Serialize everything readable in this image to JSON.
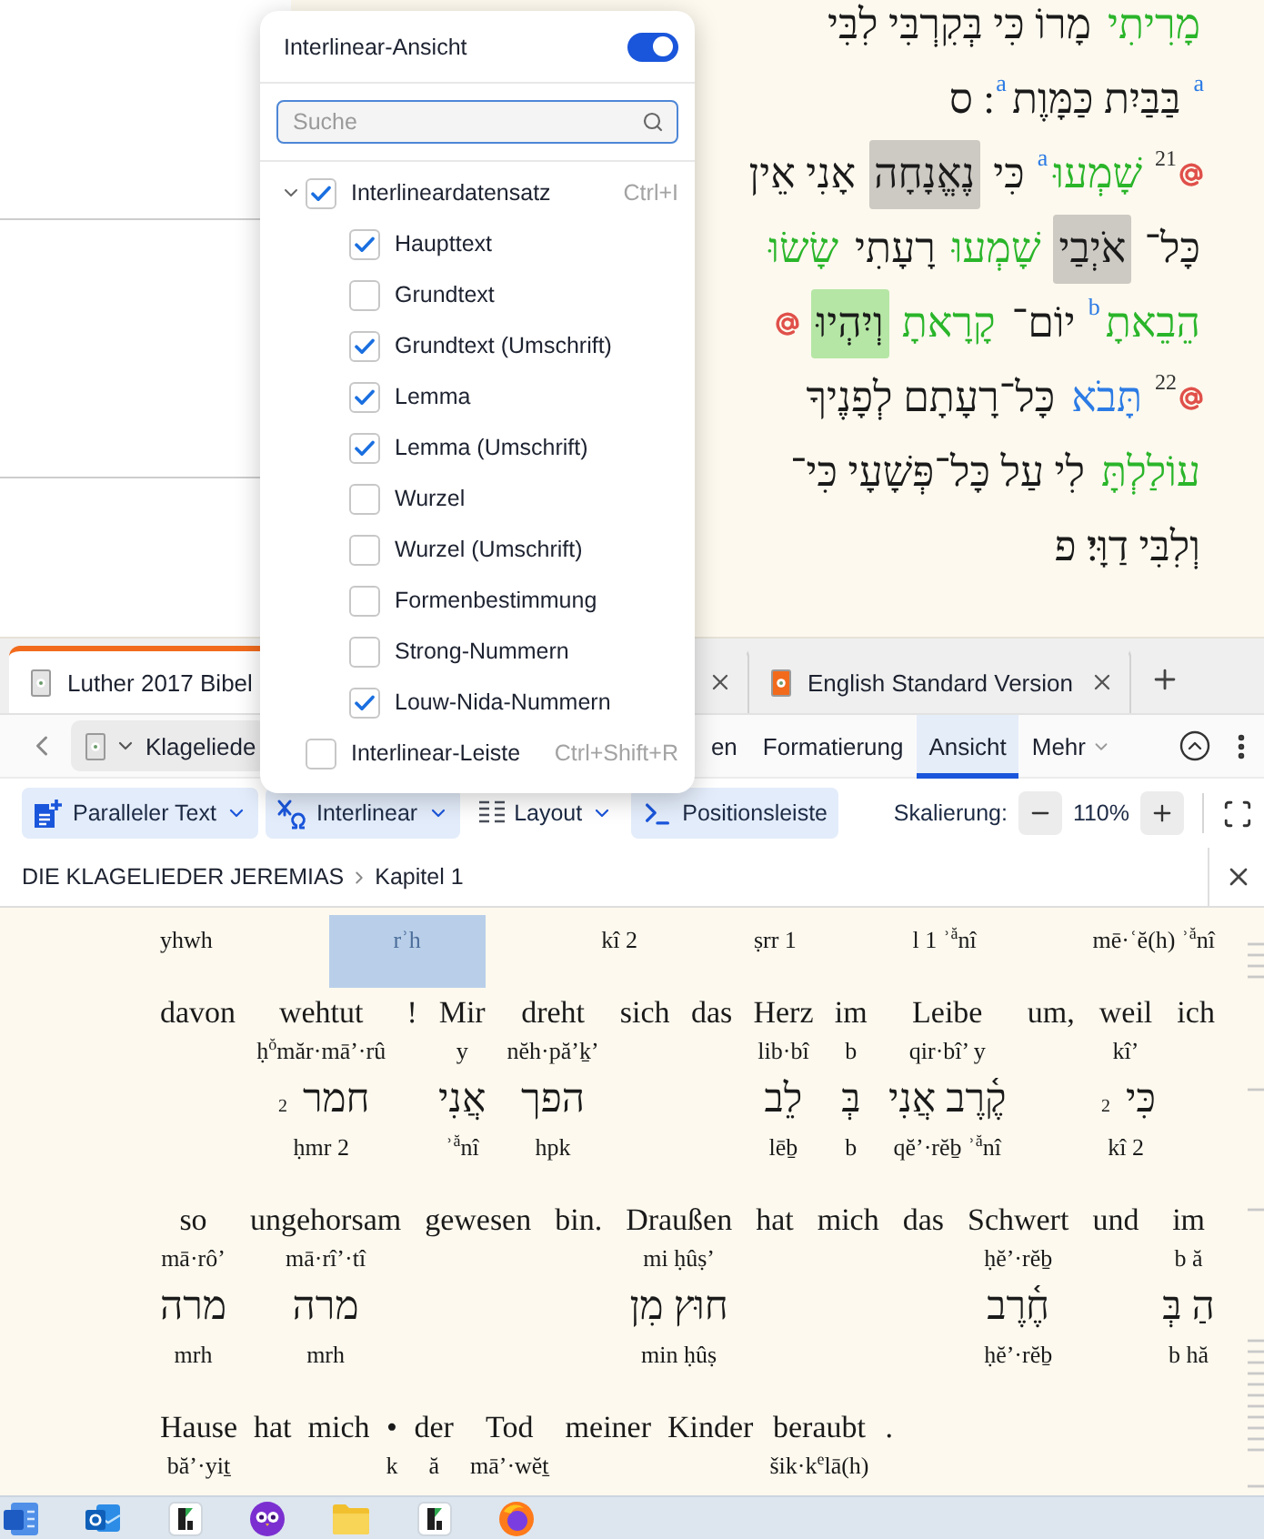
{
  "hebrew_text": {
    "lines": [
      {
        "segments": [
          {
            "kind": "word",
            "text": "מָרִיתִי",
            "color": "#2ab52a"
          },
          {
            "kind": "word",
            "text": "מָרוֹ כִּי בְּקִרְבִּי לִבִּי",
            "color": "#1a1a1a"
          }
        ]
      },
      {
        "segments": [
          {
            "kind": "note",
            "text": "a",
            "color": "#2c7be5"
          },
          {
            "kind": "word",
            "text": "בַּבַּיִת כַּמָּוֶת",
            "color": "#1a1a1a"
          },
          {
            "kind": "note",
            "text": "a",
            "color": "#2c7be5"
          },
          {
            "kind": "word",
            "text": "׃ ס",
            "color": "#1a1a1a"
          }
        ]
      },
      {
        "segments": [
          {
            "kind": "link"
          },
          {
            "kind": "verse",
            "text": "21"
          },
          {
            "kind": "word",
            "text": "שָׁמְעוּ",
            "color": "#2ab52a"
          },
          {
            "kind": "note",
            "text": "a",
            "color": "#2c7be5"
          },
          {
            "kind": "word",
            "text": "כִּי",
            "color": "#1a1a1a"
          },
          {
            "kind": "highlight",
            "text": "נֶאֱנָחָה",
            "color": "#cdc9c3"
          },
          {
            "kind": "word",
            "text": "אָנִי אֵין",
            "color": "#1a1a1a"
          }
        ]
      },
      {
        "segments": [
          {
            "kind": "word",
            "text": "כָּל־",
            "color": "#1a1a1a"
          },
          {
            "kind": "highlight",
            "text": "אֹיְבַי",
            "color": "#cdc9c3"
          },
          {
            "kind": "word",
            "text": "שָׁמְעוּ",
            "color": "#2ab52a"
          },
          {
            "kind": "word",
            "text": "רָעָתִי",
            "color": "#1a1a1a"
          },
          {
            "kind": "word",
            "text": "שָׂשׂוּ",
            "color": "#2ab52a"
          }
        ]
      },
      {
        "segments": [
          {
            "kind": "word",
            "text": "הֵבֵאתָ",
            "color": "#2ab52a"
          },
          {
            "kind": "note",
            "text": "b",
            "color": "#2c7be5"
          },
          {
            "kind": "word",
            "text": "יוֹם־",
            "color": "#1a1a1a"
          },
          {
            "kind": "word",
            "text": "קָרָאתָ",
            "color": "#2ab52a"
          },
          {
            "kind": "highlight",
            "text": "וְיִהְיוּ",
            "color": "#b5e6a5"
          },
          {
            "kind": "link"
          }
        ]
      },
      {
        "segments": [
          {
            "kind": "link"
          },
          {
            "kind": "verse",
            "text": "22"
          },
          {
            "kind": "word",
            "text": "תָּבֹא",
            "color": "#2c7be5"
          },
          {
            "kind": "word",
            "text": "כָּל־רָעָתָם לְפָנֶיךָ",
            "color": "#1a1a1a"
          }
        ]
      },
      {
        "segments": [
          {
            "kind": "word",
            "text": "עוֹלַלְתָּ",
            "color": "#2ab52a"
          },
          {
            "kind": "word",
            "text": "לִי עַל כָּל־פְּשָׁעָי כִּי־",
            "color": "#1a1a1a"
          }
        ]
      },
      {
        "segments": [
          {
            "kind": "word",
            "text": "וְלִבִּי דַוָּי׃ פ",
            "color": "#1a1a1a"
          }
        ]
      }
    ]
  },
  "document_tabs": [
    {
      "label": "Luther 2017 Bibel",
      "selected": true,
      "color": "#e4e4e4"
    },
    {
      "selected": false
    },
    {
      "label": "English Standard Version",
      "selected": false,
      "color": "#f26a1b"
    }
  ],
  "navigation_bar": {
    "book_select": {
      "label": "Klageliede",
      "color": "#e4e4e4"
    },
    "tabs": [
      {
        "label": "en",
        "selected": false,
        "kind": "tab"
      },
      {
        "label": "Formatierung",
        "selected": false,
        "kind": "tab"
      },
      {
        "label": "Ansicht",
        "selected": true,
        "kind": "tab"
      },
      {
        "label": "Mehr",
        "selected": false,
        "kind": "menu"
      }
    ]
  },
  "view_toolbar": {
    "buttons": [
      {
        "label": "Paralleler Text",
        "on": true,
        "kind": "dropdown"
      },
      {
        "label": "Interlinear",
        "on": true,
        "kind": "dropdown"
      },
      {
        "label": "Layout",
        "on": false,
        "kind": "dropdown"
      },
      {
        "label": "Positionsleiste",
        "on": true,
        "kind": "toggle"
      }
    ],
    "zoom": {
      "label": "Skalierung:",
      "value": "110%"
    }
  },
  "breadcrumb": {
    "items": [
      "DIE KLAGELIEDER JEREMIAS",
      "Kapitel 1"
    ]
  },
  "interlinear": {
    "rows": [
      {
        "columns": [
          {
            "lemma_umschrift": "yhwh",
            "selected": false
          },
          {
            "lemma_umschrift": "rʾh",
            "selected": true
          },
          {
            "lemma_umschrift": "kî 2",
            "selected": false
          },
          {
            "lemma_umschrift": "ṣrr 1",
            "selected": false
          },
          {
            "lemma_umschrift": "l 1 ʾ$^{ă}$nî",
            "selected": false
          },
          {
            "lemma_umschrift": "mē·ʿĕ(h) ʾ$^{ă}$nî",
            "selected": false
          }
        ]
      },
      {
        "columns": [
          {
            "haupttext": "davon",
            "selected": false
          },
          {
            "haupttext": "wehtut",
            "grundtext_umschrift": "ḥ$^{ŏ}$măr·mā’·rû",
            "lemma_umschrift": "ḥmr 2",
            "selected": false
          },
          {
            "haupttext": "!",
            "selected": false
          },
          {
            "haupttext": "Mir",
            "grundtext_umschrift": "y",
            "lemma_umschrift": "ʾ$^{ă}$nî",
            "selected": false
          },
          {
            "haupttext": "dreht",
            "grundtext_umschrift": "nĕh·pă’ḵ’",
            "lemma_umschrift": "hpk",
            "selected": false
          },
          {
            "haupttext": "sich",
            "selected": false
          },
          {
            "haupttext": "das",
            "selected": false
          },
          {
            "haupttext": "Herz",
            "grundtext_umschrift": "lib·bî",
            "lemma_umschrift": "lēḇ",
            "selected": false
          },
          {
            "haupttext": "im",
            "grundtext_umschrift": "b",
            "lemma_umschrift": "b",
            "selected": false
          },
          {
            "haupttext": "Leibe",
            "grundtext_umschrift": "qir·bî’ y",
            "lemma_umschrift": "qĕ’·rĕḇ ʾ$^{ă}$nî",
            "selected": false
          },
          {
            "haupttext": "um,",
            "selected": false
          },
          {
            "haupttext": "weil",
            "grundtext_umschrift": "kî’",
            "lemma_umschrift": "kî 2",
            "selected": false
          },
          {
            "haupttext": "ich",
            "selected": false
          }
        ],
        "lemmas": [
          "כִּי $_{2}$",
          "קֶ֫רֶב אֲנִי",
          "בְּ",
          "לֵב",
          "הפך",
          "אֲנִי",
          "חמר $_{2}$"
        ]
      },
      {
        "columns": [
          {
            "haupttext": "so",
            "grundtext_umschrift": "mā·rô’",
            "lemma_umschrift": "mrh",
            "selected": false
          },
          {
            "haupttext": "ungehorsam",
            "grundtext_umschrift": "mā·rî’·tî",
            "lemma_umschrift": "mrh",
            "selected": false
          },
          {
            "haupttext": "gewesen",
            "selected": false
          },
          {
            "haupttext": "bin.",
            "selected": false
          },
          {
            "haupttext": "Draußen",
            "grundtext_umschrift": "mi ḥûṣ’",
            "lemma_umschrift": "min ḥûṣ",
            "selected": false
          },
          {
            "haupttext": "hat",
            "selected": false
          },
          {
            "haupttext": "mich",
            "selected": false
          },
          {
            "haupttext": "das",
            "selected": false
          },
          {
            "haupttext": "Schwert",
            "grundtext_umschrift": "ḥĕ’·rĕḇ",
            "lemma_umschrift": "ḥĕ’·rĕḇ",
            "selected": false
          },
          {
            "haupttext": "und",
            "selected": false
          },
          {
            "haupttext": "im",
            "grundtext_umschrift": "b ă",
            "lemma_umschrift": "b hă",
            "selected": false
          }
        ],
        "lemmas": [
          "הַ בְּ",
          "חֶ֫רֶב",
          "חוּץ מִן",
          "מרה",
          "מרה"
        ]
      },
      {
        "columns": [
          {
            "haupttext": "Hause",
            "grundtext_umschrift": "bă’·yiṯ",
            "selected": false
          },
          {
            "haupttext": "hat",
            "selected": false
          },
          {
            "haupttext": "mich",
            "selected": false
          },
          {
            "haupttext": "•",
            "grundtext_umschrift": "k",
            "selected": false
          },
          {
            "haupttext": "der",
            "grundtext_umschrift": "ă",
            "selected": false
          },
          {
            "haupttext": "Tod",
            "grundtext_umschrift": "mā’·wĕṯ",
            "selected": false
          },
          {
            "haupttext": "meiner",
            "selected": false
          },
          {
            "haupttext": "Kinder",
            "selected": false
          },
          {
            "haupttext": "beraubt",
            "grundtext_umschrift": "šik·k$^{e}$lā(h)",
            "selected": false
          },
          {
            "haupttext": ".",
            "selected": false
          }
        ]
      }
    ]
  },
  "interlinear_menu": {
    "title": "Interlinear-Ansicht",
    "toggle": {
      "on": true
    },
    "search": {
      "placeholder": "Suche"
    },
    "items": [
      {
        "label": "Interlineardatensatz",
        "shortcut": "Ctrl+I",
        "checked": true,
        "expanded": true,
        "children": [
          {
            "label": "Haupttext",
            "checked": true
          },
          {
            "label": "Grundtext",
            "checked": false
          },
          {
            "label": "Grundtext (Umschrift)",
            "checked": true
          },
          {
            "label": "Lemma",
            "checked": true
          },
          {
            "label": "Lemma (Umschrift)",
            "checked": true
          },
          {
            "label": "Wurzel",
            "checked": false
          },
          {
            "label": "Wurzel (Umschrift)",
            "checked": false
          },
          {
            "label": "Formenbestimmung",
            "checked": false
          },
          {
            "label": "Strong-Nummern",
            "checked": false
          },
          {
            "label": "Louw-Nida-Nummern",
            "checked": true
          }
        ]
      },
      {
        "label": "Interlinear-Leiste",
        "shortcut": "Ctrl+Shift+R",
        "checked": false
      }
    ]
  }
}
